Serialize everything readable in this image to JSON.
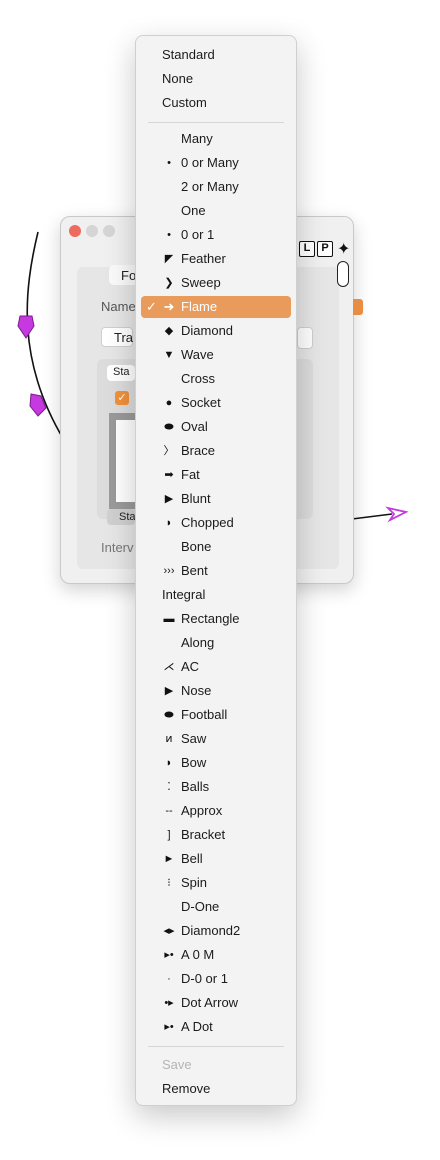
{
  "menu": {
    "top_items": [
      {
        "label": "Standard",
        "icon": "",
        "selected": false
      },
      {
        "label": "None",
        "icon": "",
        "selected": false
      },
      {
        "label": "Custom",
        "icon": "",
        "selected": false
      }
    ],
    "arrow_items": [
      {
        "label": "Many",
        "icon": "",
        "glyph": "",
        "selected": false
      },
      {
        "label": "0 or Many",
        "icon": "dot-icon",
        "glyph": "•",
        "selected": false
      },
      {
        "label": "2 or Many",
        "icon": "",
        "glyph": "",
        "selected": false
      },
      {
        "label": "One",
        "icon": "",
        "glyph": "",
        "selected": false
      },
      {
        "label": "0 or 1",
        "icon": "dot-icon",
        "glyph": "•",
        "selected": false
      },
      {
        "label": "Feather",
        "icon": "feather-arrow-icon",
        "glyph": "◤",
        "selected": false
      },
      {
        "label": "Sweep",
        "icon": "sweep-arrow-icon",
        "glyph": "❯",
        "selected": false
      },
      {
        "label": "Flame",
        "icon": "flame-arrow-icon",
        "glyph": "➜",
        "selected": true
      },
      {
        "label": "Diamond",
        "icon": "diamond-icon",
        "glyph": "◆",
        "selected": false
      },
      {
        "label": "Wave",
        "icon": "wave-arrow-icon",
        "glyph": "▼",
        "selected": false
      },
      {
        "label": "Cross",
        "icon": "",
        "glyph": "",
        "selected": false
      },
      {
        "label": "Socket",
        "icon": "socket-icon",
        "glyph": "●",
        "selected": false
      },
      {
        "label": "Oval",
        "icon": "oval-icon",
        "glyph": "⬬",
        "selected": false
      },
      {
        "label": "Brace",
        "icon": "brace-icon",
        "glyph": "〉",
        "selected": false
      },
      {
        "label": "Fat",
        "icon": "fat-arrow-icon",
        "glyph": "➡",
        "selected": false
      },
      {
        "label": "Blunt",
        "icon": "blunt-arrow-icon",
        "glyph": "▶",
        "selected": false
      },
      {
        "label": "Chopped",
        "icon": "chopped-arrow-icon",
        "glyph": "◗",
        "selected": false
      },
      {
        "label": "Bone",
        "icon": "",
        "glyph": "",
        "selected": false
      },
      {
        "label": "Bent",
        "icon": "bent-arrow-icon",
        "glyph": "›››",
        "selected": false
      }
    ],
    "integral_label": "Integral",
    "integral_items": [
      {
        "label": "Rectangle",
        "icon": "rectangle-icon",
        "glyph": "▬",
        "selected": false
      },
      {
        "label": "Along",
        "icon": "",
        "glyph": "",
        "selected": false
      },
      {
        "label": "AC",
        "icon": "ac-arrow-icon",
        "glyph": "⋌",
        "selected": false
      },
      {
        "label": "Nose",
        "icon": "nose-arrow-icon",
        "glyph": "▶",
        "selected": false
      },
      {
        "label": "Football",
        "icon": "football-icon",
        "glyph": "⬬",
        "selected": false
      },
      {
        "label": "Saw",
        "icon": "saw-arrow-icon",
        "glyph": "ͷ",
        "selected": false
      },
      {
        "label": "Bow",
        "icon": "bow-arrow-icon",
        "glyph": "◗",
        "selected": false
      },
      {
        "label": "Balls",
        "icon": "balls-icon",
        "glyph": "⁚",
        "selected": false
      },
      {
        "label": "Approx",
        "icon": "approx-icon",
        "glyph": "--",
        "selected": false
      },
      {
        "label": "Bracket",
        "icon": "bracket-icon",
        "glyph": "]",
        "selected": false
      },
      {
        "label": "Bell",
        "icon": "bell-arrow-icon",
        "glyph": "►",
        "selected": false
      },
      {
        "label": "Spin",
        "icon": "spin-icon",
        "glyph": "⁝",
        "selected": false
      },
      {
        "label": "D-One",
        "icon": "",
        "glyph": "",
        "selected": false
      },
      {
        "label": "Diamond2",
        "icon": "diamond2-icon",
        "glyph": "◂▸",
        "selected": false
      },
      {
        "label": "A 0 M",
        "icon": "a0m-arrow-icon",
        "glyph": "▸•",
        "selected": false
      },
      {
        "label": "D-0 or 1",
        "icon": "small-dot-icon",
        "glyph": "·",
        "selected": false
      },
      {
        "label": "Dot Arrow",
        "icon": "dot-arrow-icon",
        "glyph": "•▸",
        "selected": false
      },
      {
        "label": "A Dot",
        "icon": "a-dot-icon",
        "glyph": "▸•",
        "selected": false
      }
    ],
    "footer_items": [
      {
        "label": "Save",
        "disabled": true
      },
      {
        "label": "Remove",
        "disabled": false
      }
    ]
  },
  "window": {
    "tab_label": "Fo",
    "name_label": "Name",
    "name_value": "Tra",
    "style_label_top": "Sta",
    "style_label_bottom": "Sta",
    "interval_label": "Interv",
    "toolbar": {
      "l_button": "L",
      "p_button": "P"
    }
  },
  "colors": {
    "accent": "#e89b5a",
    "arrowhead": "#c638e0",
    "checkbox": "#f0913a"
  }
}
